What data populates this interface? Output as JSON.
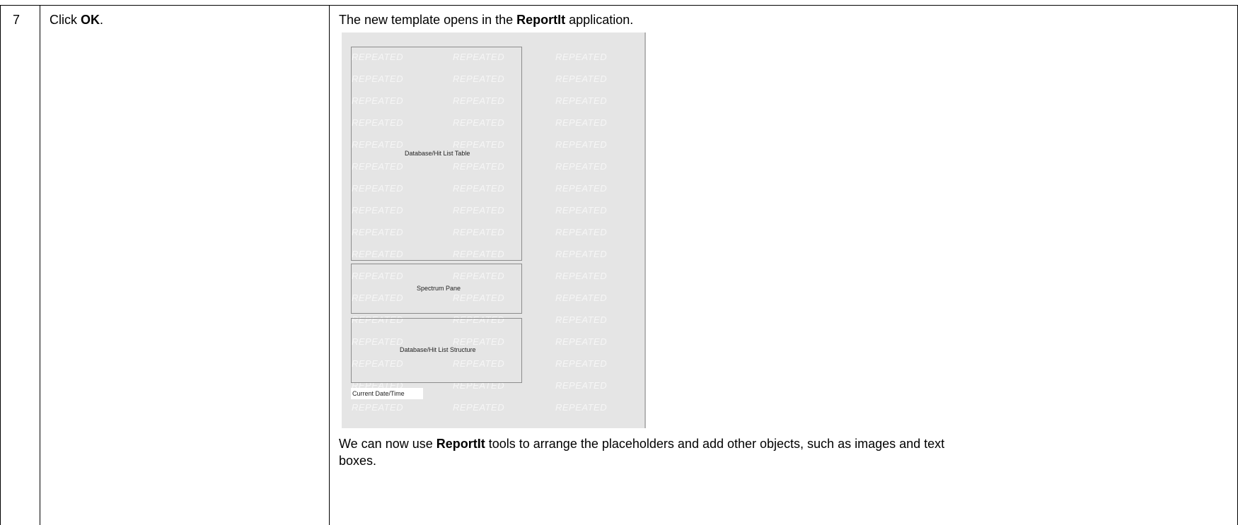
{
  "row": {
    "step_number": "7",
    "instruction": {
      "prefix": "Click ",
      "bold": "OK",
      "suffix": "."
    },
    "result_intro": {
      "prefix": "The new template opens in the ",
      "bold": "ReportIt",
      "suffix": " application."
    },
    "result_outro": {
      "prefix": "We can now use ",
      "bold": "ReportIt",
      "line1_suffix": " tools to arrange the placeholders and add other objects, such as images and text",
      "line2": "boxes."
    }
  },
  "screenshot": {
    "watermark_text": "REPEATED",
    "placeholders": {
      "hit_list_table": "Database/Hit List Table",
      "spectrum_pane": "Spectrum Pane",
      "hit_list_structure": "Database/Hit List Structure",
      "date_time": "Current Date/Time"
    }
  }
}
